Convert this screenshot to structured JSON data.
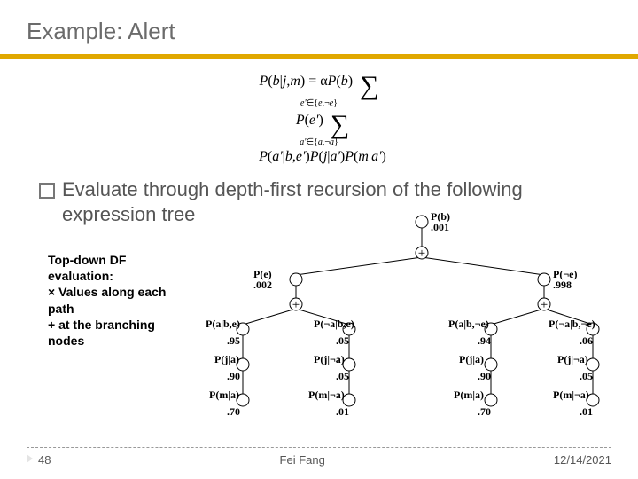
{
  "title": "Example: Alert",
  "formula_html": "<span><i>P</i>(<i>b</i>|<i>j</i>,<i>m</i>) = α<i>P</i>(<i>b</i>) &nbsp;<span class='big'>∑</span><span class='sub'><i>e'</i>∈{<i>e</i>,¬<i>e</i>}</span>&nbsp; <i>P</i>(<i>e'</i>) &nbsp;<span class='big'>∑</span><span class='sub'><i>a'</i>∈{<i>a</i>,¬<i>a</i>}</span>&nbsp; <i>P</i>(<i>a'</i>|<i>b</i>,<i>e'</i>)<i>P</i>(<i>j</i>|<i>a'</i>)<i>P</i>(<i>m</i>|<i>a'</i>)</span>",
  "bullet_text": "Evaluate through depth-first recursion of the following expression tree",
  "topdown": {
    "l1": "Top-down DF",
    "l2": "evaluation:",
    "l3": "  × Values along each",
    "l4": "path",
    "l5": "  + at the branching",
    "l6": "nodes"
  },
  "tree": {
    "root": {
      "label": "P(b)",
      "value": ".001"
    },
    "plus1": "+",
    "e": {
      "label": "P(e)",
      "value": ".002"
    },
    "ne": {
      "label": "P(¬e)",
      "value": ".998"
    },
    "abe": {
      "label": "P(a|b,e)",
      "value": ".95"
    },
    "nabe": {
      "label": "P(¬a|b,e)",
      "value": ".05"
    },
    "abne": {
      "label": "P(a|b,¬e)",
      "value": ".94"
    },
    "nabne": {
      "label": "P(¬a|b,¬e)",
      "value": ".06"
    },
    "ja": {
      "label": "P(j|a)",
      "value": ".90"
    },
    "jna": {
      "label": "P(j|¬a)",
      "value": ".05"
    },
    "ma": {
      "label": "P(m|a)",
      "value": ".70"
    },
    "mna": {
      "label": "P(m|¬a)",
      "value": ".01"
    }
  },
  "footer": {
    "page": "48",
    "author": "Fei Fang",
    "date": "12/14/2021"
  }
}
